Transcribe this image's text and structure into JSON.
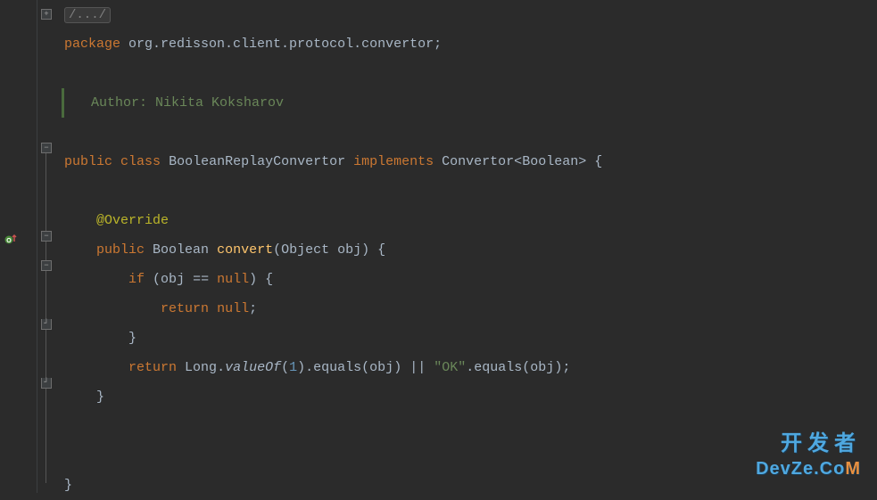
{
  "folded_header": "/.../",
  "package_kw": "package",
  "package_name": "org.redisson.client.protocol.convertor",
  "author_label": "Author: Nikita Koksharov",
  "public_kw": "public",
  "class_kw": "class",
  "class_name": "BooleanReplayConvertor",
  "implements_kw": "implements",
  "interface_name": "Convertor",
  "generic_type": "Boolean",
  "annotation": "@Override",
  "return_type": "Boolean",
  "method_name": "convert",
  "param_type": "Object",
  "param_name": "obj",
  "if_kw": "if",
  "null_kw": "null",
  "return_kw": "return",
  "long_class": "Long",
  "valueof_method": "valueOf",
  "number_one": "1",
  "equals_method": "equals",
  "ok_string": "\"OK\"",
  "eq_op": "==",
  "or_op": "||",
  "watermark_top": "开发者",
  "watermark_bottom_main": "DevZe.Co",
  "watermark_bottom_end": "M"
}
